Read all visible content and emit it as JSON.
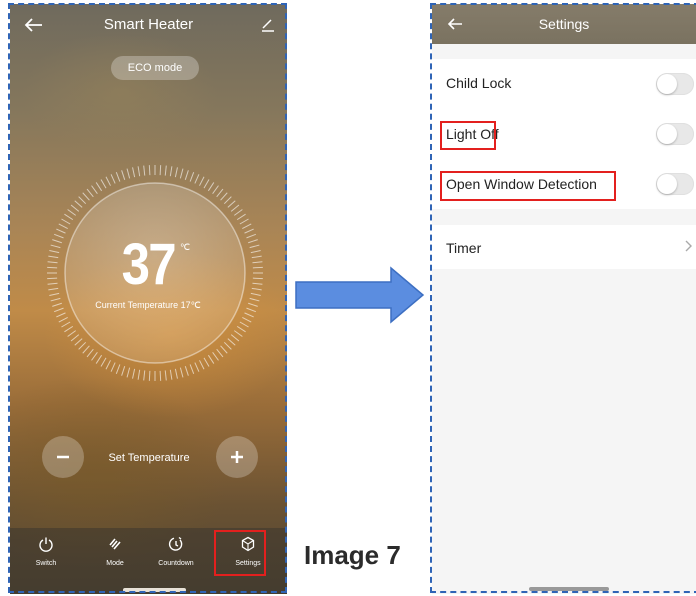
{
  "left_screen": {
    "header": {
      "title": "Smart  Heater"
    },
    "mode_badge": "ECO mode",
    "temperature": {
      "value": "37",
      "unit": "℃",
      "current_label": "Current Temperature 17℃"
    },
    "set_temperature_label": "Set Temperature",
    "nav": [
      {
        "label": "Switch",
        "icon": "power-icon"
      },
      {
        "label": "Mode",
        "icon": "mode-icon"
      },
      {
        "label": "Countdown",
        "icon": "countdown-icon"
      },
      {
        "label": "Settings",
        "icon": "settings-icon"
      }
    ]
  },
  "caption": "Image 7",
  "right_screen": {
    "header": {
      "title": "Settings"
    },
    "rows": [
      {
        "label": "Child Lock",
        "toggle_on": false
      },
      {
        "label": "Light Off",
        "toggle_on": false
      },
      {
        "label": "Open Window Detection",
        "toggle_on": false
      }
    ],
    "timer_row": {
      "label": "Timer",
      "chevron": "›"
    }
  },
  "colors": {
    "highlight": "#e3201e",
    "border_dashed": "#2f64b6",
    "arrow": "#5b8de0",
    "settings_header": "#7f7765"
  }
}
